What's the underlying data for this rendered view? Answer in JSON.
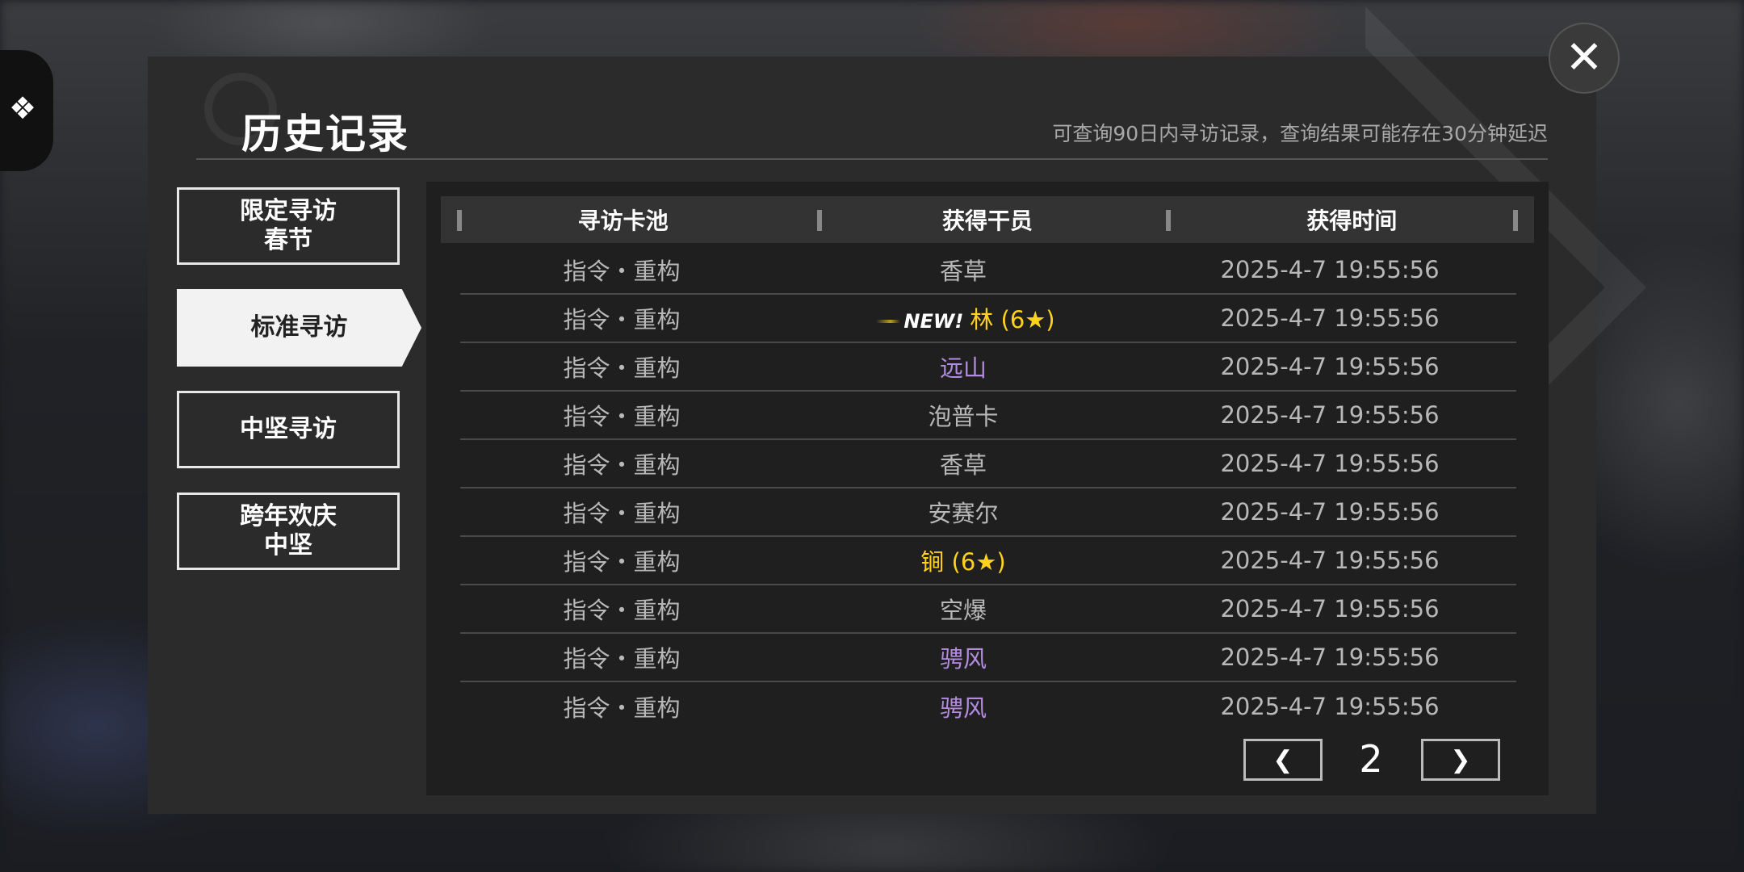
{
  "header": {
    "title": "历史记录",
    "notice": "可查询90日内寻访记录，查询结果可能存在30分钟延迟"
  },
  "sidebar": {
    "items": [
      {
        "label": "限定寻访\n春节",
        "active": false
      },
      {
        "label": "标准寻访",
        "active": true
      },
      {
        "label": "中坚寻访",
        "active": false
      },
      {
        "label": "跨年欢庆\n中坚",
        "active": false
      }
    ]
  },
  "table": {
    "columns": [
      "寻访卡池",
      "获得干员",
      "获得时间"
    ],
    "rows": [
      {
        "pool": "指令・重构",
        "operator": "香草",
        "time": "2025-4-7 19:55:56",
        "color": "#b8b8b8",
        "new": ""
      },
      {
        "pool": "指令・重构",
        "operator": "林 (6★)",
        "time": "2025-4-7 19:55:56",
        "color": "#ffd21e",
        "new": "NEW!"
      },
      {
        "pool": "指令・重构",
        "operator": "远山",
        "time": "2025-4-7 19:55:56",
        "color": "#b38ce0",
        "new": ""
      },
      {
        "pool": "指令・重构",
        "operator": "泡普卡",
        "time": "2025-4-7 19:55:56",
        "color": "#b8b8b8",
        "new": ""
      },
      {
        "pool": "指令・重构",
        "operator": "香草",
        "time": "2025-4-7 19:55:56",
        "color": "#b8b8b8",
        "new": ""
      },
      {
        "pool": "指令・重构",
        "operator": "安赛尔",
        "time": "2025-4-7 19:55:56",
        "color": "#b8b8b8",
        "new": ""
      },
      {
        "pool": "指令・重构",
        "operator": "锏 (6★)",
        "time": "2025-4-7 19:55:56",
        "color": "#ffd21e",
        "new": ""
      },
      {
        "pool": "指令・重构",
        "operator": "空爆",
        "time": "2025-4-7 19:55:56",
        "color": "#b8b8b8",
        "new": ""
      },
      {
        "pool": "指令・重构",
        "operator": "骋风",
        "time": "2025-4-7 19:55:56",
        "color": "#b38ce0",
        "new": ""
      },
      {
        "pool": "指令・重构",
        "operator": "骋风",
        "time": "2025-4-7 19:55:56",
        "color": "#b38ce0",
        "new": ""
      }
    ]
  },
  "pager": {
    "page": "2",
    "prev_icon": "chevron-left-icon",
    "next_icon": "chevron-right-icon"
  },
  "icons": {
    "close": "close-icon",
    "left_tab": "puzzle-icon"
  }
}
